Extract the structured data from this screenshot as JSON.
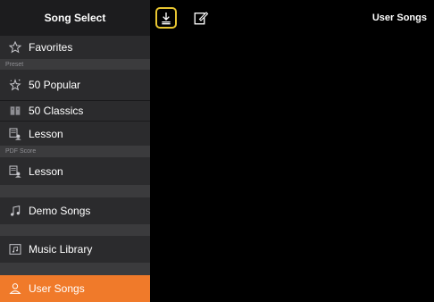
{
  "sidebar": {
    "title": "Song Select",
    "favorites": "Favorites",
    "preset_label": "Preset",
    "popular": "50 Popular",
    "classics": "50 Classics",
    "lesson": "Lesson",
    "pdf_score_label": "PDF Score",
    "pdf_lesson": "Lesson",
    "demo_songs": "Demo Songs",
    "music_library": "Music Library",
    "user_songs": "User Songs"
  },
  "main": {
    "title": "User Songs"
  },
  "colors": {
    "accent": "#f07a2a",
    "highlight_border": "#e7c531"
  }
}
